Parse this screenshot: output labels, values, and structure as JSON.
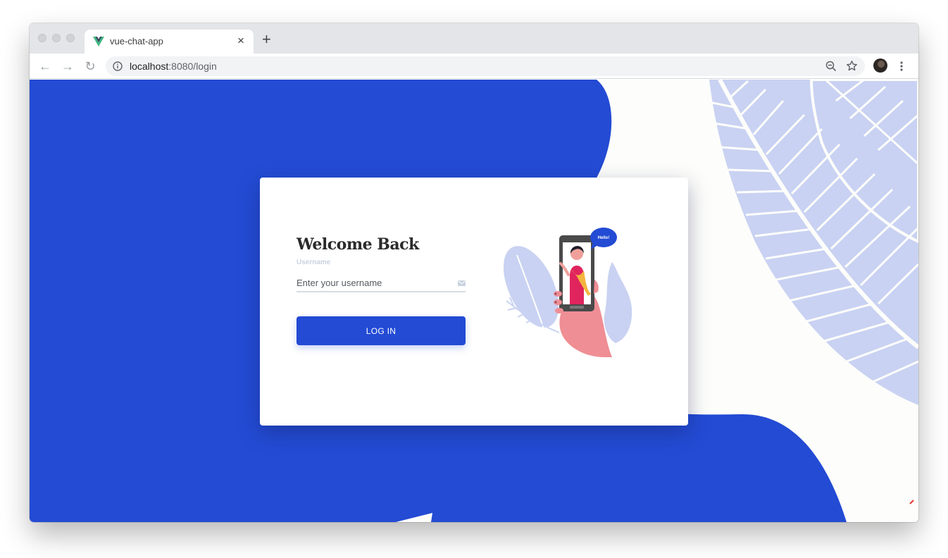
{
  "browser": {
    "tab_title": "vue-chat-app",
    "tab_close": "×",
    "new_tab": "+",
    "url_host": "localhost",
    "url_rest": ":8080/login",
    "nav": {
      "back": "←",
      "forward": "→",
      "reload": "↻"
    }
  },
  "login": {
    "title": "Welcome Back",
    "username_label": "Username",
    "username_placeholder": "Enter your username",
    "username_value": "",
    "submit_label": "LOG IN"
  },
  "illustration": {
    "bubble_text": "Hello!"
  },
  "colors": {
    "primary_blue": "#234bd4",
    "leaf_lavender": "#c9d2f2",
    "card_background": "#ffffff"
  },
  "icons": [
    "vue-favicon-icon",
    "close-icon",
    "plus-icon",
    "back-arrow-icon",
    "forward-arrow-icon",
    "reload-icon",
    "info-icon",
    "zoom-out-icon",
    "star-icon",
    "profile-avatar",
    "menu-dots-icon",
    "mail-icon"
  ]
}
